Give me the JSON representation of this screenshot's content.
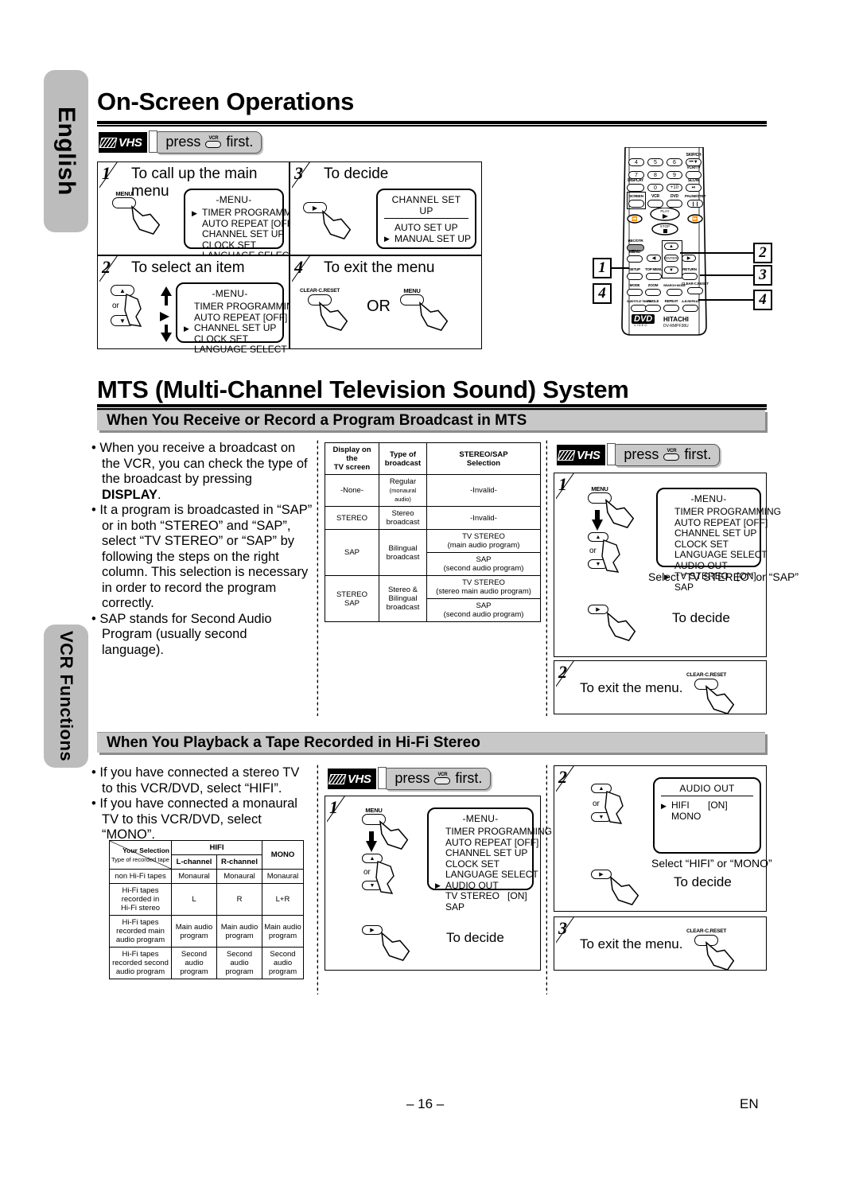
{
  "page": {
    "footer_page": "– 16 –",
    "footer_lang": "EN"
  },
  "side_tabs": [
    {
      "id": "english",
      "label": "English"
    },
    {
      "id": "vcr",
      "label": "VCR Functions"
    }
  ],
  "section_onscreen": {
    "title": "On-Screen Operations",
    "press_first": {
      "vhs": "VHS",
      "press": "press",
      "key": "VCR",
      "first": "first."
    },
    "steps": [
      {
        "num": "1",
        "title": "To call up the main menu",
        "button": "MENU",
        "osd": {
          "head": "-MENU-",
          "underline": false,
          "items": [
            {
              "label": "TIMER PROGRAMMING",
              "value": "",
              "current": true
            },
            {
              "label": "AUTO REPEAT",
              "value": "[OFF]",
              "current": false
            },
            {
              "label": "CHANNEL SET UP",
              "value": "",
              "current": false
            },
            {
              "label": "CLOCK SET",
              "value": "",
              "current": false
            },
            {
              "label": "LANGUAGE SELECT",
              "value": "",
              "current": false
            }
          ]
        }
      },
      {
        "num": "3",
        "title": "To decide",
        "button": "▶",
        "osd": {
          "head": "CHANNEL SET UP",
          "underline": true,
          "items": [
            {
              "label": "AUTO SET UP",
              "value": "",
              "current": false
            },
            {
              "label": "MANUAL SET UP",
              "value": "",
              "current": true
            }
          ]
        }
      },
      {
        "num": "2",
        "title": "To select an item",
        "button_up": "▲",
        "button_down": "▼",
        "or": "or",
        "osd": {
          "head": "-MENU-",
          "underline": false,
          "items": [
            {
              "label": "TIMER PROGRAMMING",
              "value": "",
              "current": false
            },
            {
              "label": "AUTO REPEAT",
              "value": "[OFF]",
              "current": false
            },
            {
              "label": "CHANNEL SET UP",
              "value": "",
              "current": true
            },
            {
              "label": "CLOCK SET",
              "value": "",
              "current": false
            },
            {
              "label": "LANGUAGE SELECT",
              "value": "",
              "current": false
            }
          ]
        }
      },
      {
        "num": "4",
        "title": "To exit the menu",
        "button_left": "CLEAR·C.RESET",
        "or": "OR",
        "button_right": "MENU"
      }
    ]
  },
  "remote": {
    "brand": "HITACHI",
    "model": "DV-RMPF38U",
    "logo": "DVD",
    "logo_sub": "VIDEO",
    "keys_row1": [
      "4",
      "5",
      "6"
    ],
    "keys_row2": [
      "7",
      "8",
      "9"
    ],
    "keys_row3": [
      "0",
      "+10"
    ],
    "labels": {
      "skipch": "SKIP/CH",
      "vcrtv": "VCR/TV",
      "display": "DISPLAY",
      "slow": "SLOW",
      "screen": "SCREEN",
      "vcr": "VCR",
      "dvd": "DVD",
      "pausestep": "PAUSE/STEP",
      "play": "PLAY",
      "stop": "STOP",
      "recotr": "REC/OTR",
      "menu": "MENU",
      "enter": "ENTER",
      "setup": "SETUP",
      "topmenu": "TOP MENU",
      "return": "RETURN",
      "mode": "MODE",
      "zoom": "ZOOM",
      "searchmode": "SEARCH MODE",
      "clear": "CLEAR·C.RESET",
      "subtitle": "SUBTITLE·TIMER",
      "angle": "ANGLE",
      "repeat": "REPEAT",
      "abrepeat": "A-B REPEAT"
    },
    "callouts": [
      "1",
      "2",
      "3",
      "4",
      "4"
    ]
  },
  "section_mts": {
    "title": "MTS (Multi-Channel Television Sound) System",
    "band1": "When You Receive or Record a Program Broadcast in MTS",
    "bullets": [
      "When you receive a broadcast on the VCR, you can check the type of the broadcast by pressing ",
      "It a program is broadcasted in “SAP” or in both “STEREO” and “SAP”, select “TV STEREO” or “SAP” by following the steps on the right column. This selection is necessary in order to record the program correctly.",
      "SAP stands for Second Audio Program (usually second language)."
    ],
    "bold_word": "DISPLAY",
    "bullet1_tail": ".",
    "table": {
      "headers": [
        "Display on the\nTV screen",
        "Type of\nbroadcast",
        "STEREO/SAP\nSelection"
      ],
      "rows": [
        {
          "display": "-None-",
          "type": "Regular",
          "type_sub": "(monaural audio)",
          "sel": [
            "-Invalid-"
          ]
        },
        {
          "display": "STEREO",
          "type": "Stereo\nbroadcast",
          "type_sub": "",
          "sel": [
            "-Invalid-"
          ]
        },
        {
          "display": "SAP",
          "type": "Bilingual\nbroadcast",
          "type_sub": "",
          "sel": [
            "TV STEREO\n(main audio program)",
            "SAP\n(second audio program)"
          ]
        },
        {
          "display": "STEREO\nSAP",
          "type": "Stereo &\nBilingual\nbroadcast",
          "type_sub": "",
          "sel": [
            "TV STEREO\n(stereo main audio program)",
            "SAP\n(second audio program)"
          ]
        }
      ]
    },
    "press_first": {
      "vhs": "VHS",
      "press": "press",
      "key": "VCR",
      "first": "first."
    },
    "step1": {
      "num": "1",
      "button": "MENU",
      "or": "or",
      "osd": {
        "head": "-MENU-",
        "underline": false,
        "items": [
          {
            "label": "TIMER PROGRAMMING",
            "value": "",
            "current": false
          },
          {
            "label": "AUTO REPEAT",
            "value": "[OFF]",
            "current": false
          },
          {
            "label": "CHANNEL SET UP",
            "value": "",
            "current": false
          },
          {
            "label": "CLOCK SET",
            "value": "",
            "current": false
          },
          {
            "label": "LANGUAGE SELECT",
            "value": "",
            "current": false
          },
          {
            "label": "AUDIO OUT",
            "value": "",
            "current": false
          },
          {
            "label": "TV STEREO",
            "value": "[ON]",
            "current": true
          },
          {
            "label": "SAP",
            "value": "",
            "current": false
          }
        ]
      },
      "select_note": "Select “TV STEREO” or “SAP”",
      "decide": "To decide"
    },
    "step2": {
      "num": "2",
      "title": "To exit the menu.",
      "button": "CLEAR·C.RESET"
    }
  },
  "section_hifi": {
    "band": "When You Playback a Tape Recorded in Hi-Fi Stereo",
    "bullets": [
      "If you have connected a stereo TV to this VCR/DVD, select “HIFI”.",
      "If you have connected a monaural TV to this VCR/DVD, select “MONO”."
    ],
    "table": {
      "corner_top": "Your Selection",
      "corner_bottom": "Type of recorded tape",
      "group_hifi": "HIFI",
      "col_l": "L-channel",
      "col_r": "R-channel",
      "col_mono": "MONO",
      "rows": [
        {
          "type": "non Hi-Fi tapes",
          "l": "Monaural",
          "r": "Monaural",
          "m": "Monaural"
        },
        {
          "type": "Hi-Fi tapes\nrecorded in\nHi-Fi stereo",
          "l": "L",
          "r": "R",
          "m": "L+R"
        },
        {
          "type": "Hi-Fi tapes\nrecorded main\naudio program",
          "l": "Main audio\nprogram",
          "r": "Main audio\nprogram",
          "m": "Main audio\nprogram"
        },
        {
          "type": "Hi-Fi tapes\nrecorded second\naudio program",
          "l": "Second audio\nprogram",
          "r": "Second audio\nprogram",
          "m": "Second audio\nprogram"
        }
      ]
    },
    "press_first": {
      "vhs": "VHS",
      "press": "press",
      "key": "VCR",
      "first": "first."
    },
    "step1": {
      "num": "1",
      "button": "MENU",
      "or": "or",
      "osd": {
        "head": "-MENU-",
        "underline": false,
        "items": [
          {
            "label": "TIMER PROGRAMMING",
            "value": "",
            "current": false
          },
          {
            "label": "AUTO REPEAT",
            "value": "[OFF]",
            "current": false
          },
          {
            "label": "CHANNEL SET UP",
            "value": "",
            "current": false
          },
          {
            "label": "CLOCK SET",
            "value": "",
            "current": false
          },
          {
            "label": "LANGUAGE SELECT",
            "value": "",
            "current": false
          },
          {
            "label": "AUDIO OUT",
            "value": "",
            "current": true
          },
          {
            "label": "TV STEREO",
            "value": "[ON]",
            "current": false
          },
          {
            "label": "SAP",
            "value": "",
            "current": false
          }
        ]
      },
      "decide": "To decide"
    },
    "step2": {
      "num": "2",
      "or": "or",
      "osd": {
        "head": "AUDIO OUT",
        "underline": true,
        "items": [
          {
            "label": "HIFI",
            "value": "[ON]",
            "current": true
          },
          {
            "label": "MONO",
            "value": "",
            "current": false
          }
        ]
      },
      "select_note": "Select “HIFI” or “MONO”",
      "decide": "To decide"
    },
    "step3": {
      "num": "3",
      "title": "To exit the menu.",
      "button": "CLEAR·C.RESET"
    }
  }
}
